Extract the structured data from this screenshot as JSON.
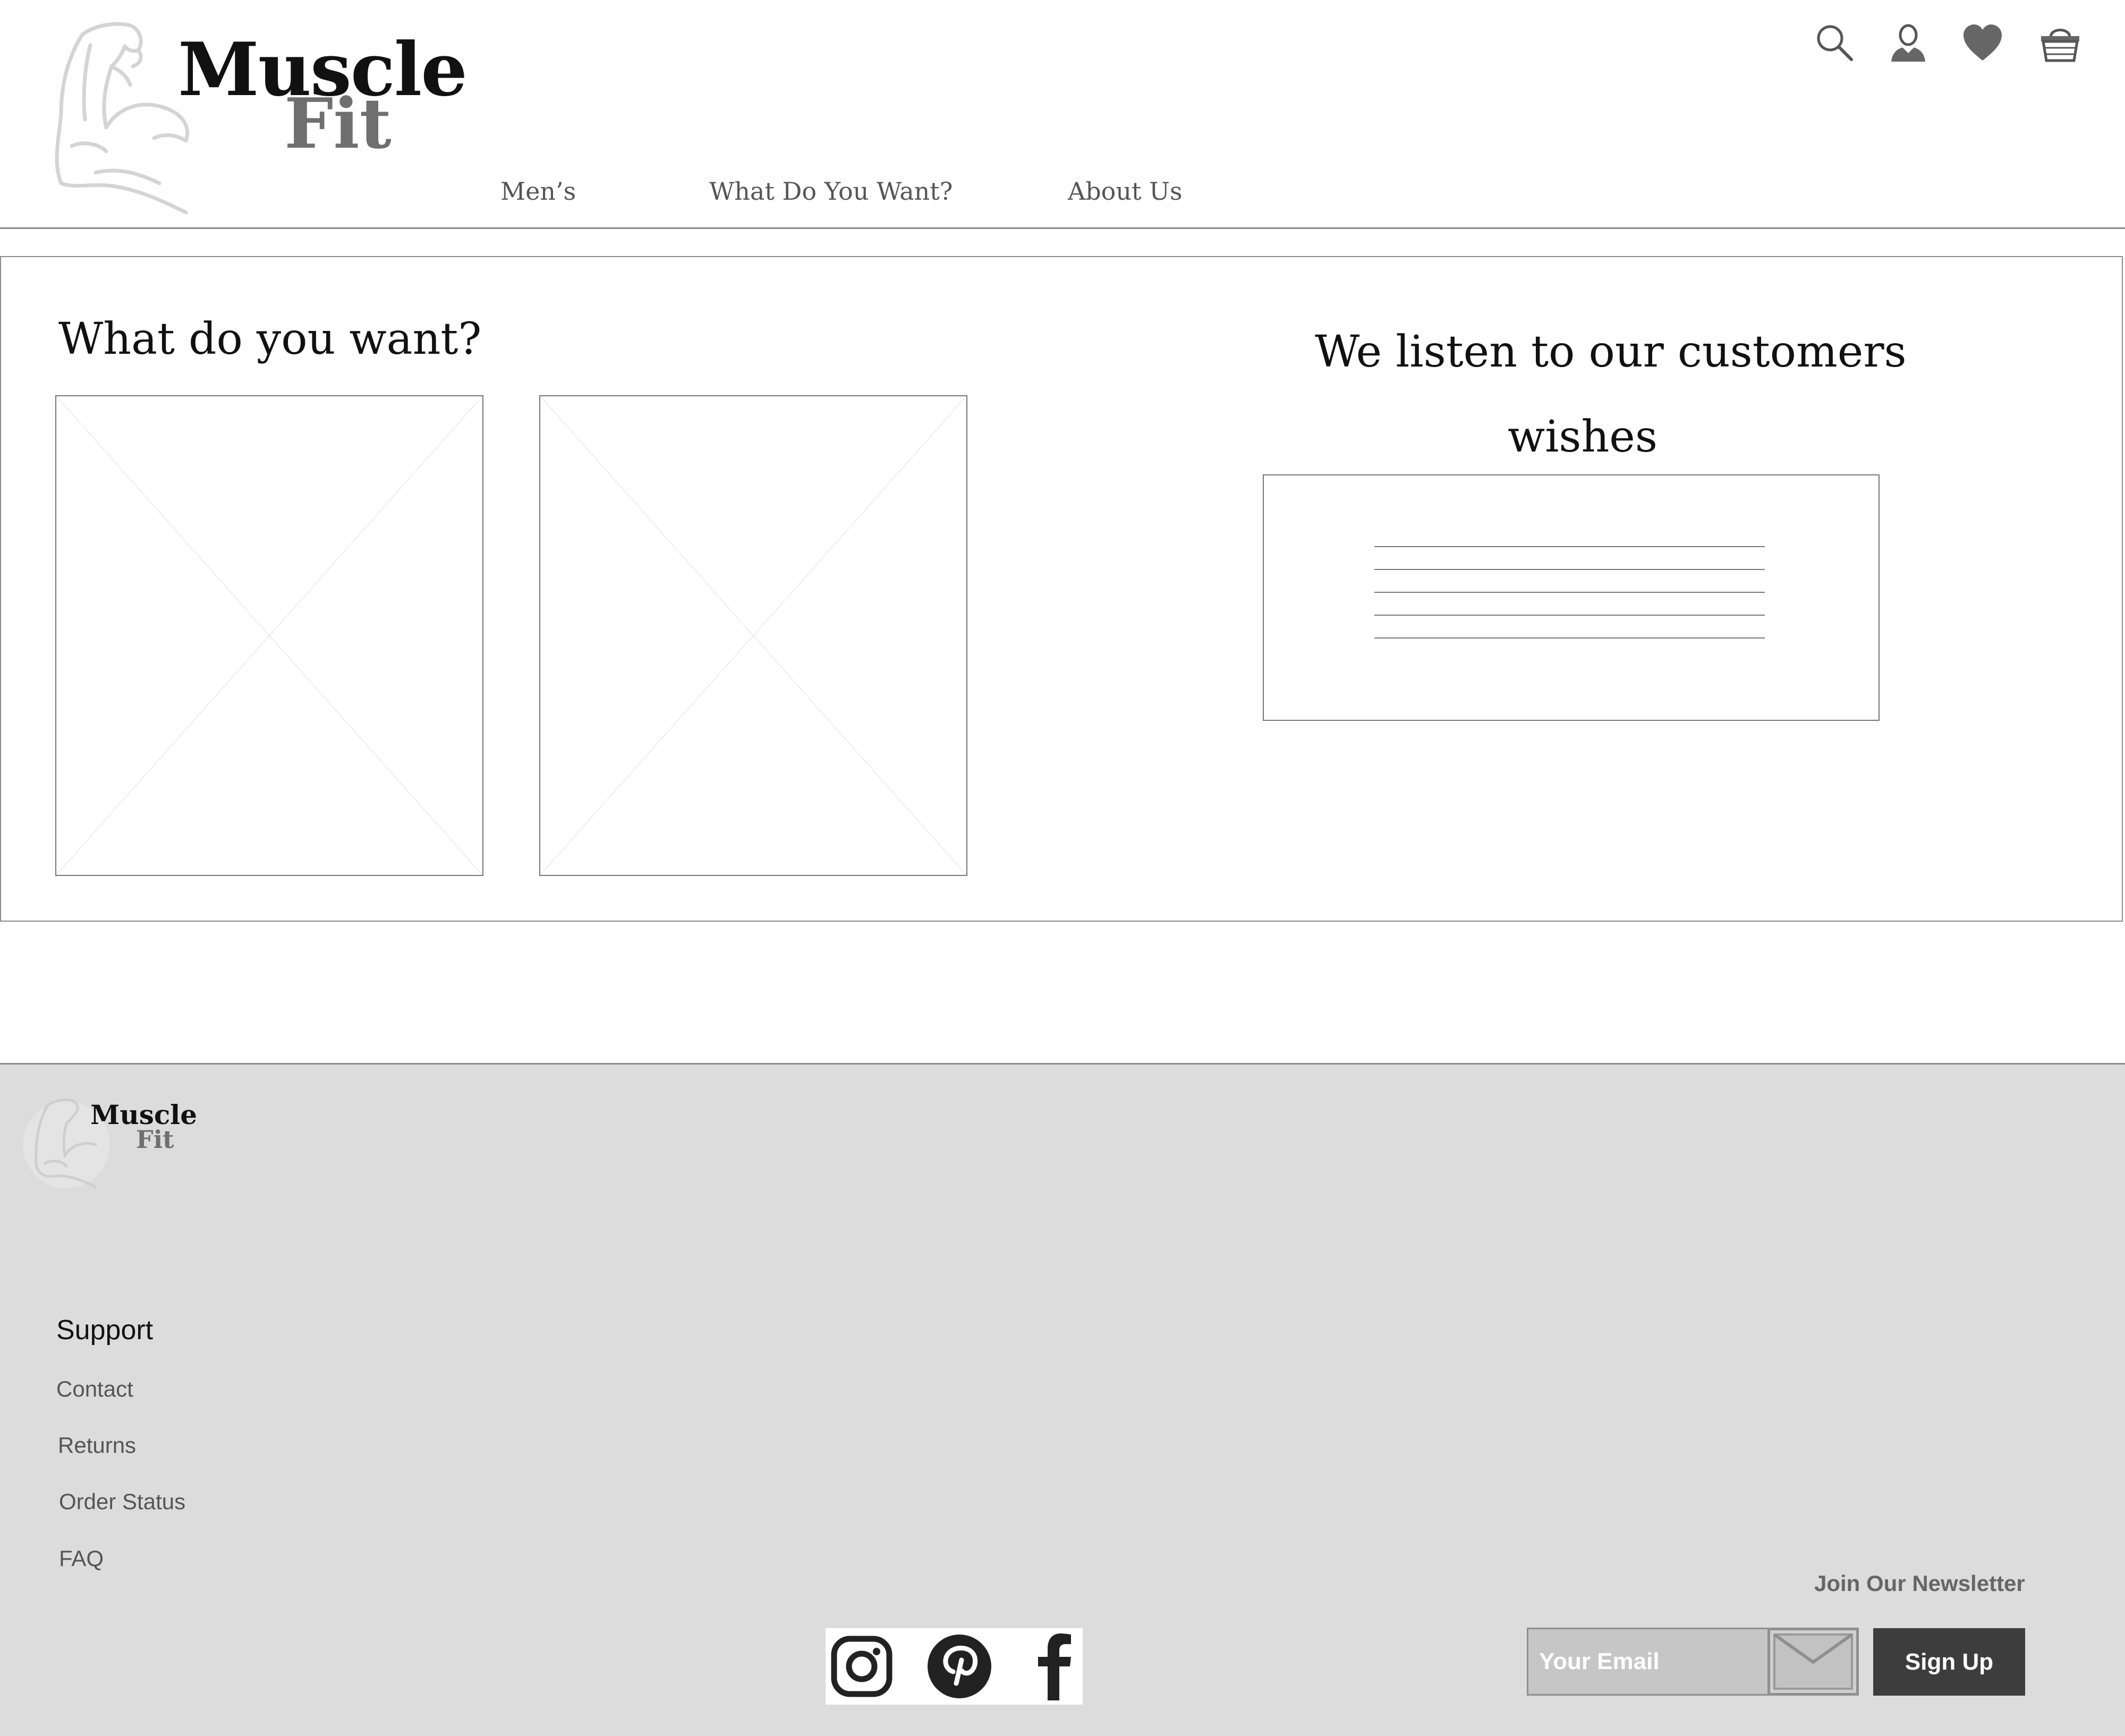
{
  "brand": {
    "name_line1": "Muscle",
    "name_line2": "Fit"
  },
  "nav": {
    "items": [
      {
        "label": "Men’s"
      },
      {
        "label": "What Do You Want?"
      },
      {
        "label": "About Us"
      }
    ]
  },
  "header_icons": [
    "search-icon",
    "user-icon",
    "heart-icon",
    "basket-icon"
  ],
  "main": {
    "left_title": "What do you want?",
    "right_title_line1": "We listen to our customers",
    "right_title_line2": "wishes"
  },
  "footer": {
    "brand": {
      "name_line1": "Muscle",
      "name_line2": "Fit"
    },
    "support": {
      "heading": "Support",
      "links": [
        {
          "label": "Contact"
        },
        {
          "label": "Returns"
        },
        {
          "label": "Order Status"
        },
        {
          "label": "FAQ"
        }
      ]
    },
    "newsletter": {
      "heading": "Join Our Newsletter",
      "email_placeholder": "Your Email",
      "signup_label": "Sign Up"
    },
    "social": [
      "instagram-icon",
      "pinterest-icon",
      "facebook-icon"
    ]
  },
  "colors": {
    "footer_bg": "#dcdcdc",
    "signup_bg": "#3d3d3d",
    "text_dark": "#111111",
    "text_muted": "#555555"
  }
}
